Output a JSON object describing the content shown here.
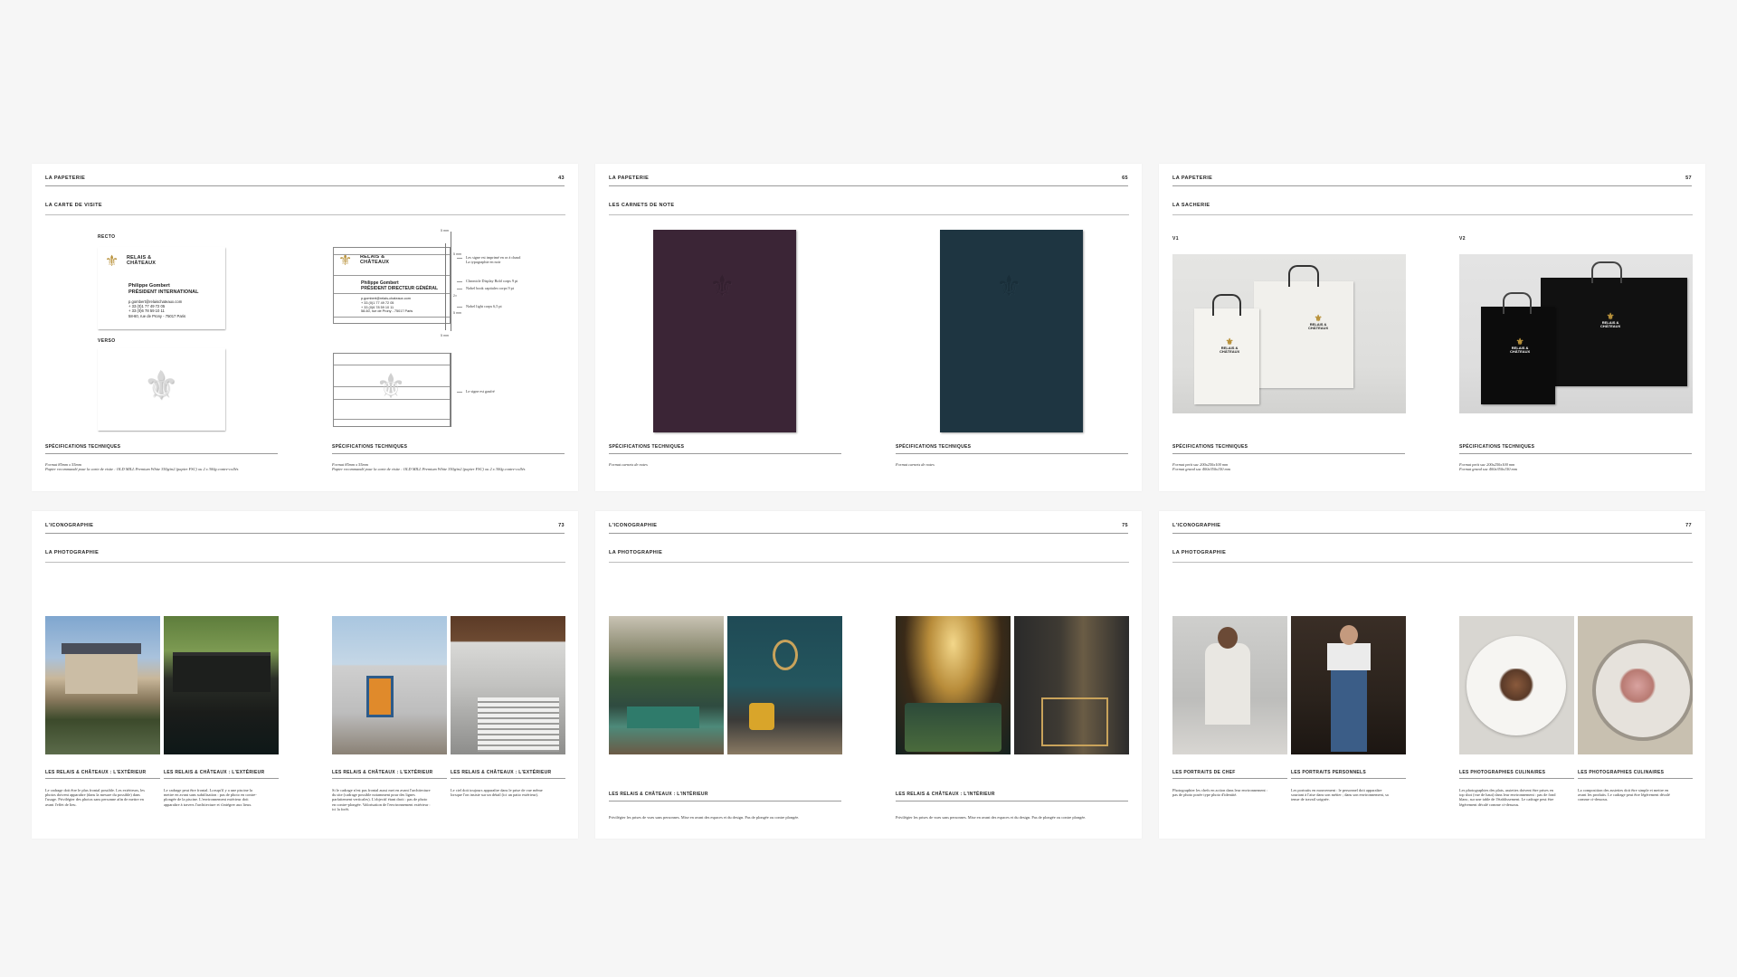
{
  "pages": [
    {
      "section": "LA PAPETERIE",
      "number": "43",
      "subtitle": "LA CARTE DE VISITE",
      "labels": {
        "recto": "RECTO",
        "verso": "VERSO"
      },
      "card": {
        "brand_line1": "RELAIS &",
        "brand_line2": "CHÂTEAUX",
        "name": "Philippe Gombert",
        "title": "PRÉSIDENT INTERNATIONAL",
        "contact": [
          "p.gombert@relaischateaux.com",
          "+ 33 (0)1 77 49 72 05",
          "+ 33 (0)6 78 59 10 11",
          "58-60, rue de Prony - 75017 Paris"
        ]
      },
      "card2": {
        "name": "Philippe Gombert",
        "title": "PRÉSIDENT DIRECTEUR GÉNÉRAL",
        "contact": [
          "p.gombert@relais-chateaux.com",
          "+ 33 (0)1 77 49 72 05",
          "+ 33 (0)6 78 59 10 11",
          "58-60, rue de Prony - 75017 Paris"
        ]
      },
      "annotations": {
        "a1": "Les signe est imprimé en or à chaud",
        "a1b": "La typographie en noir",
        "a2": "Chronicle Display Bold corps 9 pt",
        "a3": "Nobel book capitales corps 9 pt",
        "a4": "Nobel light corps 6,5 pt",
        "a5": "Le signe est gaufré"
      },
      "dims": {
        "d1": "5 mm",
        "d2": "5 mm",
        "d3": "2×",
        "d4": "5 mm",
        "d5": "5 mm"
      },
      "specs": [
        {
          "title": "SPÉCIFICATIONS TECHNIQUES",
          "text": "Format 85mm x 55mm\nPapier recommandé pour la carte de visite : OLD MILL Premium White 350g/m2 (papier FSC) ou 2 x 300g contre-collés"
        },
        {
          "title": "SPÉCIFICATIONS TECHNIQUES",
          "text": "Format 85mm x 55mm\nPapier recommandé pour la carte de visite : OLD MILL Premium White 350g/m2 (papier FSC) ou 2 x 300g contre-collés"
        }
      ]
    },
    {
      "section": "LA PAPETERIE",
      "number": "65",
      "subtitle": "LES CARNETS DE NOTE",
      "colors": {
        "plum": "#3b2536",
        "teal": "#1e3541"
      },
      "specs": [
        {
          "title": "SPÉCIFICATIONS TECHNIQUES",
          "text": "Format carnets de notes"
        },
        {
          "title": "SPÉCIFICATIONS TECHNIQUES",
          "text": "Format carnets de notes"
        }
      ]
    },
    {
      "section": "LA PAPETERIE",
      "number": "57",
      "subtitle": "LA SACHERIE",
      "labels": {
        "v1": "V1",
        "v2": "V2"
      },
      "bag_logo1": "RELAIS &",
      "bag_logo2": "CHÂTEAUX",
      "specs": [
        {
          "title": "SPÉCIFICATIONS TECHNIQUES",
          "text": "Format petit sac 200x250x100 mm\nFormat grand sac 400x350x150 mm"
        },
        {
          "title": "SPÉCIFICATIONS TECHNIQUES",
          "text": "Format petit sac 200x250x100 mm\nFormat grand sac 400x350x150 mm"
        }
      ]
    },
    {
      "section": "L'ICONOGRAPHIE",
      "number": "73",
      "subtitle": "LA PHOTOGRAPHIE",
      "captions": [
        {
          "title": "LES RELAIS & CHÂTEAUX : L'EXTÉRIEUR",
          "text": "Le cadrage doit être le plus frontal possible. Les extérieurs, les photos doivent apparaître (dans la mesure du possible) dans l'usage. Privilégier des photos sans personne afin de mettre en avant l'effet de lieu."
        },
        {
          "title": "LES RELAIS & CHÂTEAUX : L'EXTÉRIEUR",
          "text": "Le cadrage peut être frontal. Lorsqu'il y a une piscine la mettre en avant sans subtilisation : pas de photo en contre-plongée de la piscine. L'environnement extérieur doit apparaître à travers l'architecture et s'intégrer aux lieux."
        },
        {
          "title": "LES RELAIS & CHÂTEAUX : L'EXTÉRIEUR",
          "text": "Si le cadrage n'est pas frontal aussi met en avant l'architecture du site (cadrage possible notamment pour des lignes parfaitement verticales). L'objectif étant droit : pas de photo en contre-plongée. Valorisation de l'environnement extérieur : ici la forêt."
        },
        {
          "title": "LES RELAIS & CHÂTEAUX : L'EXTÉRIEUR",
          "text": "Le ciel doit toujours apparaître dans le prise de vue même lorsque l'on insiste sur un détail (ici un patio extérieur)."
        }
      ]
    },
    {
      "section": "L'ICONOGRAPHIE",
      "number": "75",
      "subtitle": "LA PHOTOGRAPHIE",
      "captions": [
        {
          "title": "LES RELAIS & CHÂTEAUX : L'INTÉRIEUR",
          "text": "Privilégier les prises de vues sans personnes. Mise en avant des espaces et du design. Pas de plongée ou contre plongée."
        },
        {
          "title": "LES RELAIS & CHÂTEAUX : L'INTÉRIEUR",
          "text": "Privilégier les prises de vues sans personnes. Mise en avant des espaces et du design. Pas de plongée ou contre plongée."
        }
      ]
    },
    {
      "section": "L'ICONOGRAPHIE",
      "number": "77",
      "subtitle": "LA PHOTOGRAPHIE",
      "captions": [
        {
          "title": "LES PORTRAITS DE CHEF",
          "text": "Photographier les chefs en action dans leur environnement : pas de photo posée type photo d'identité."
        },
        {
          "title": "LES PORTRAITS PERSONNELS",
          "text": "Les portraits en mouvement : le personnel doit apparaître souriant à l'aise dans son métier ; dans son environnement, sa tenue de travail soignée."
        },
        {
          "title": "LES PHOTOGRAPHIES CULINAIRES",
          "text": "Les photographies des plats, assiettes doivent être prises en top shot (vue de haut) dans leur environnement : pas de fond blanc, sur une table de l'établissement. Le cadrage peut être légèrement décalé comme ci-dessous."
        },
        {
          "title": "LES PHOTOGRAPHIES CULINAIRES",
          "text": "La composition des assiettes doit être simple et mettre en avant les produits. Le cadrage peut être légèrement décalé comme ci-dessous."
        }
      ]
    }
  ]
}
